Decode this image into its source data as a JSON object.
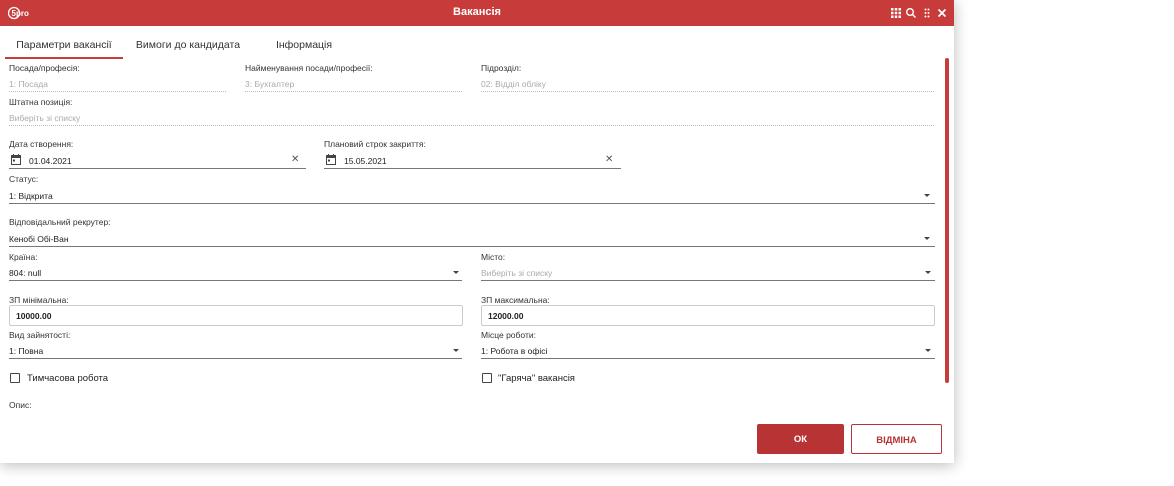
{
  "app": {
    "title": "Вакансія",
    "logo_text": "5pro"
  },
  "tabs": [
    {
      "label": "Параметри вакансії",
      "active": true
    },
    {
      "label": "Вимоги до кандидата",
      "active": false
    },
    {
      "label": "Інформація",
      "active": false
    }
  ],
  "form": {
    "position": {
      "label": "Посада/професія:",
      "value": "1: Посада"
    },
    "position_name": {
      "label": "Найменування посади/професії:",
      "value": "3: Бухгалтер"
    },
    "department": {
      "label": "Підрозділ:",
      "value": "02: Відділ обліку"
    },
    "staff_position": {
      "label": "Штатна позиція:",
      "placeholder": "Виберіть зі списку"
    },
    "created_date": {
      "label": "Дата створення:",
      "value": "01.04.2021"
    },
    "planned_close": {
      "label": "Плановий строк закриття:",
      "value": "15.05.2021"
    },
    "status": {
      "label": "Статус:",
      "value": "1: Відкрита"
    },
    "recruiter": {
      "label": "Відповідальний рекрутер:",
      "value": "Кенобі Обі-Ван"
    },
    "country": {
      "label": "Країна:",
      "value": "804: null"
    },
    "city": {
      "label": "Місто:",
      "placeholder": "Виберіть зі списку"
    },
    "salary_min": {
      "label": "ЗП мінімальна:",
      "value": "10000.00"
    },
    "salary_max": {
      "label": "ЗП максимальна:",
      "value": "12000.00"
    },
    "employment_type": {
      "label": "Вид зайнятості:",
      "value": "1: Повна"
    },
    "work_place": {
      "label": "Місце роботи:",
      "value": "1: Робота в офісі"
    },
    "temporary": {
      "label": "Тимчасова робота",
      "checked": false
    },
    "hot": {
      "label": "\"Гаряча\" вакансія",
      "checked": false
    },
    "description": {
      "label": "Опис:"
    }
  },
  "buttons": {
    "ok": "ОК",
    "cancel": "ВІДМІНА"
  },
  "icons": {
    "titlebar": [
      "grid-icon",
      "search-icon",
      "more-vert-icon",
      "close-icon"
    ],
    "date": "calendar-icon",
    "clear": "clear-icon",
    "dropdown": "chevron-down-icon"
  },
  "colors": {
    "accent": "#c73b3b",
    "button": "#b83333"
  }
}
